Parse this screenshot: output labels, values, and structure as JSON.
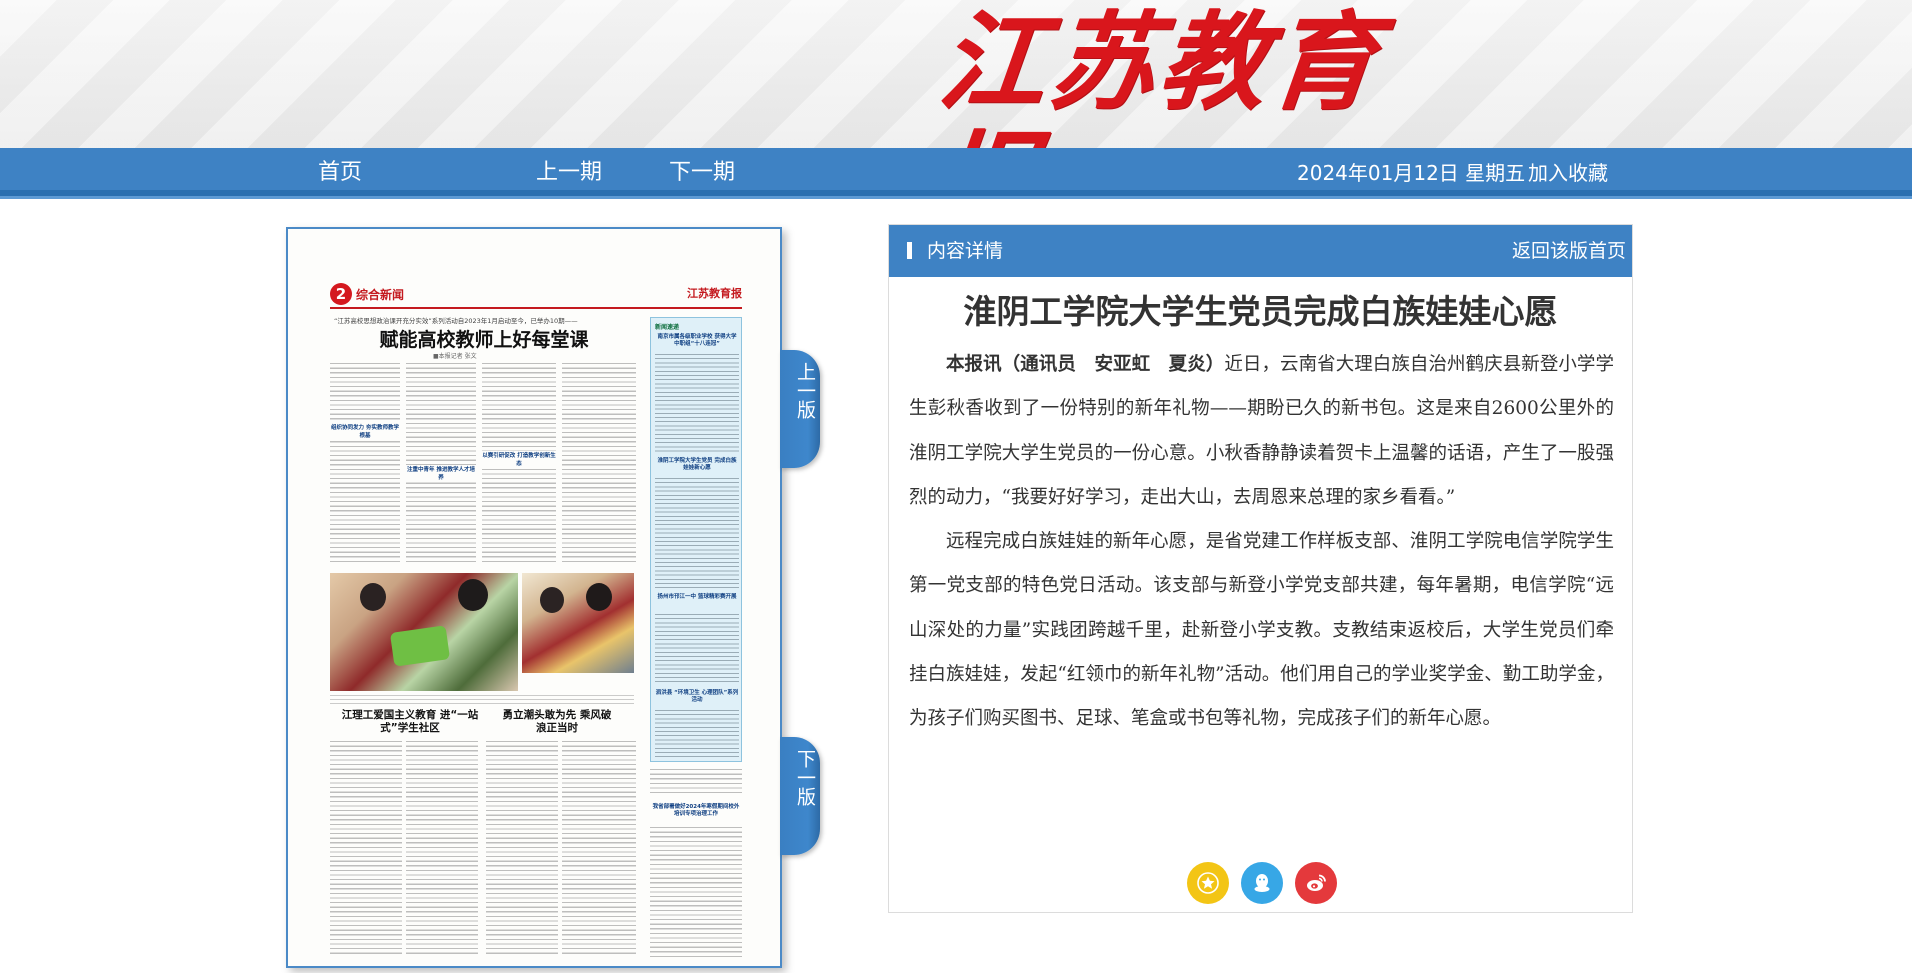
{
  "masthead": {
    "logo_text": "江苏教育报"
  },
  "nav": {
    "home": "首页",
    "prev_issue": "上一期",
    "next_issue": "下一期",
    "date": "2024年01月12日 星期五",
    "bookmark": "加入收藏"
  },
  "paper": {
    "page_number": "2",
    "section": "综合新闻",
    "edition_name": "江苏教育报",
    "kicker": "“江苏高校思想政治课开充分实效”系列活动自2023年1月启动至今，已举办10期——",
    "headline": "赋能高校教师上好每堂课",
    "byline": "■本报记者 张文",
    "subheads": [
      "组织协同发力 夯实教师教学根基",
      "注重中青年 推进教学人才培养",
      "以赛引研促改 打造教学创新生态"
    ],
    "sidebar_title": "新闻速递",
    "sidebar_heads": [
      "南京市属各级职业学校 获得大学中职组“十八连冠”",
      "淮阴工学院大学生党员 完成白族娃娃新心愿",
      "扬州市邗江一中 篮球精彩赛开展",
      "泗洪县 “环境卫生 心理团队”系列活动"
    ],
    "headline_2a": "江理工爱国主义教育 进“一站式”学生社区",
    "headline_2b": "勇立潮头敢为先 乘风破浪正当时",
    "sidebar_bottom": "我省部署做好2024年寒假期间校外培训专项治理工作"
  },
  "flip_tabs": {
    "up": "上一版",
    "down": "下一版"
  },
  "article": {
    "bar_title": "内容详情",
    "back_link": "返回该版首页",
    "title": "淮阴工学院大学生党员完成白族娃娃心愿",
    "byline": "本报讯（通讯员　安亚虹　夏炎）",
    "paragraph_1": "近日，云南省大理白族自治州鹤庆县新登小学学生彭秋香收到了一份特别的新年礼物——期盼已久的新书包。这是来自2600公里外的淮阴工学院大学生党员的一份心意。小秋香静静读着贺卡上温馨的话语，产生了一股强烈的动力，“我要好好学习，走出大山，去周恩来总理的家乡看看。”",
    "paragraph_2": "远程完成白族娃娃的新年心愿，是省党建工作样板支部、淮阴工学院电信学院学生第一党支部的特色党日活动。该支部与新登小学党支部共建，每年暑期，电信学院“远山深处的力量”实践团跨越千里，赴新登小学支教。支教结束返校后，大学生党员们牵挂白族娃娃，发起“红领巾的新年礼物”活动。他们用自己的学业奖学金、勤工助学金，为孩子们购买图书、足球、笔盒或书包等礼物，完成孩子们的新年心愿。"
  },
  "share": {
    "icons": [
      "star-icon",
      "qq-icon",
      "weibo-icon"
    ],
    "colors": {
      "favorite": "#f3c515",
      "qq": "#37a7e6",
      "weibo": "#e4393c"
    }
  },
  "colors": {
    "nav_blue": "#3e82c4",
    "logo_red": "#d9161c"
  }
}
